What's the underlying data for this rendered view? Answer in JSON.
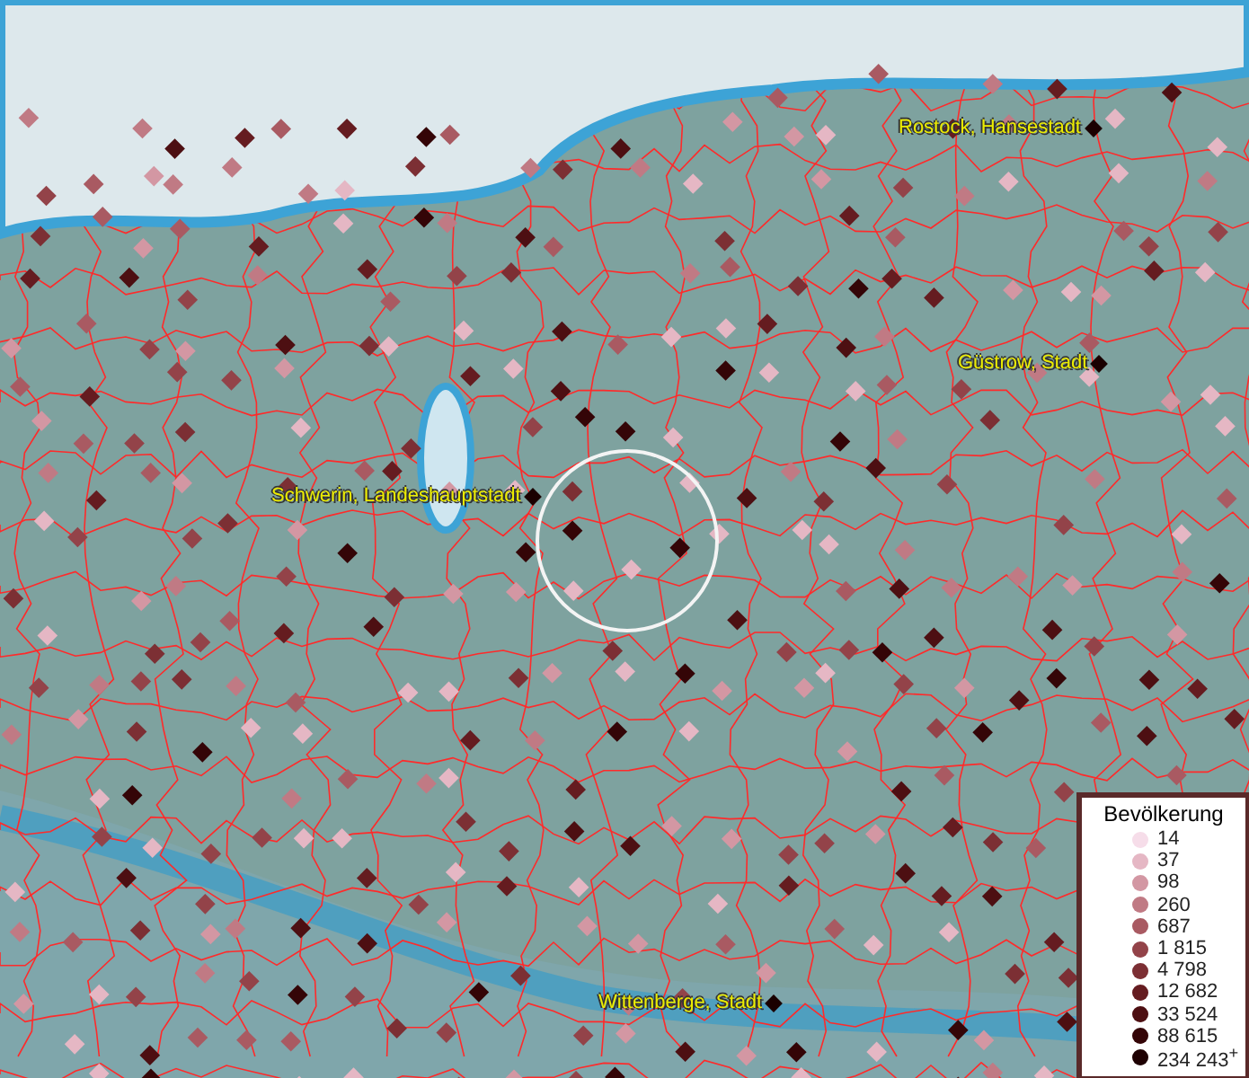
{
  "cities": [
    {
      "name": "Rostock, Hansestadt"
    },
    {
      "name": "Güstrow, Stadt"
    },
    {
      "name": "Schwerin, Landeshauptstadt"
    },
    {
      "name": "Wittenberge, Stadt"
    }
  ],
  "legend": {
    "title": "Bevölkerung",
    "items": [
      {
        "label": "14",
        "color": "#f6dde9"
      },
      {
        "label": "37",
        "color": "#e5b7c4"
      },
      {
        "label": "98",
        "color": "#d397a3"
      },
      {
        "label": "260",
        "color": "#c07a84"
      },
      {
        "label": "687",
        "color": "#a95a62"
      },
      {
        "label": "1 815",
        "color": "#934349"
      },
      {
        "label": "4 798",
        "color": "#7c2f34"
      },
      {
        "label": "12 682",
        "color": "#651c20"
      },
      {
        "label": "33 524",
        "color": "#4d0f12"
      },
      {
        "label": "88 615",
        "color": "#340507"
      },
      {
        "label": "234 243$^{+}$",
        "color": "#1e0102"
      }
    ]
  }
}
